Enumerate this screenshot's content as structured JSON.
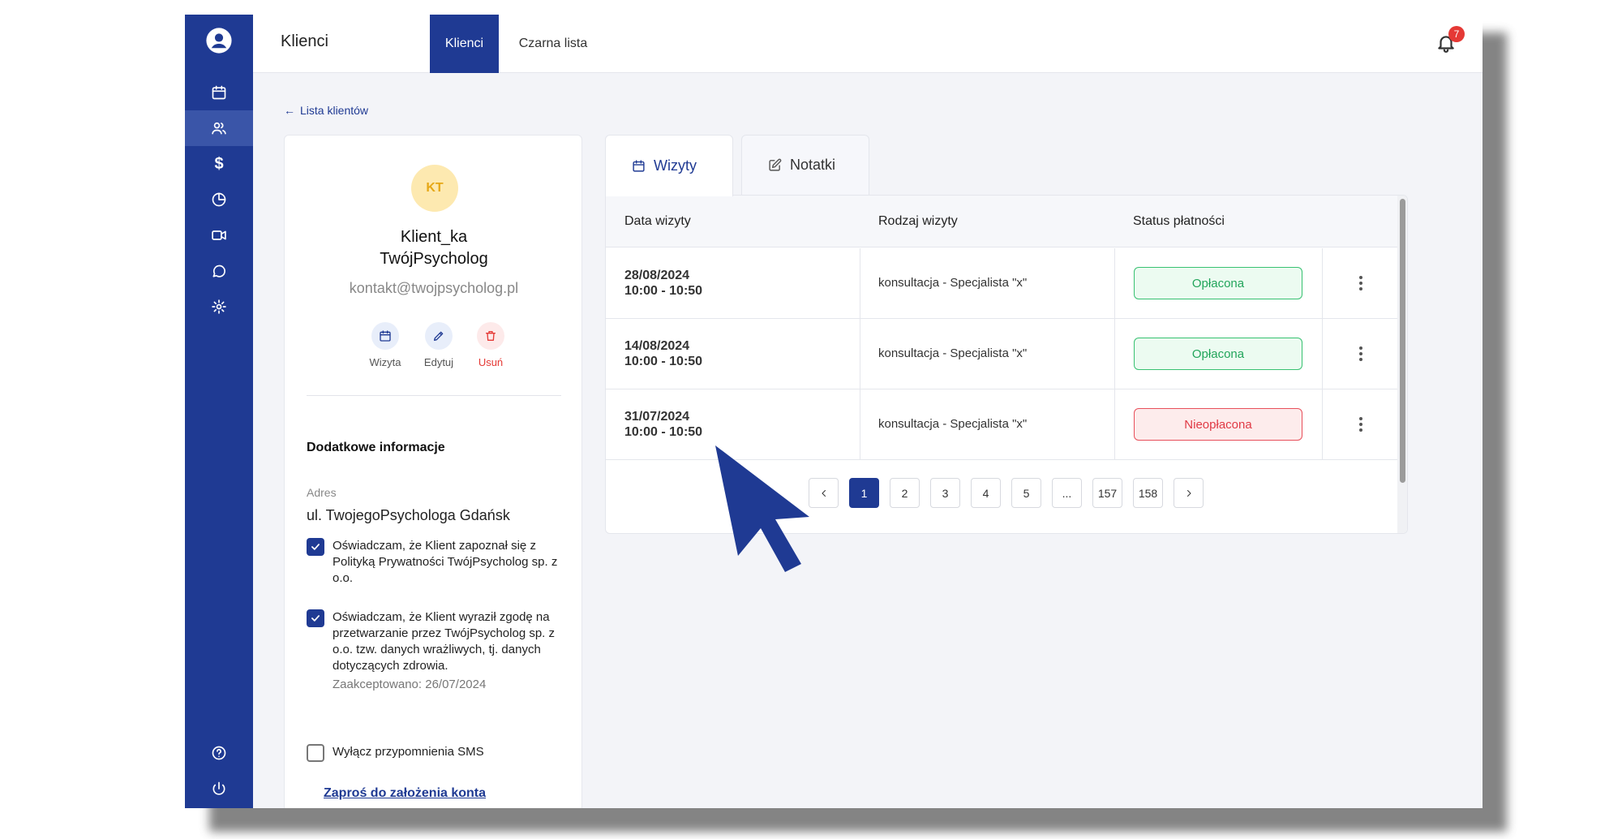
{
  "header": {
    "title": "Klienci",
    "tabs": [
      {
        "label": "Klienci",
        "active": true
      },
      {
        "label": "Czarna lista",
        "active": false
      }
    ],
    "notifications_count": "7"
  },
  "sidebar": {
    "items": [
      "user-circle-icon",
      "calendar-icon",
      "users-icon",
      "dollar-icon",
      "pie-chart-icon",
      "video-icon",
      "chat-icon",
      "gear-icon",
      "help-icon",
      "power-icon"
    ],
    "active_item": "users-icon",
    "dollar_glyph": "$"
  },
  "back_link": "Lista klientów",
  "client": {
    "initials": "KT",
    "name_line1": "Klient_ka",
    "name_line2": "TwójPsycholog",
    "email": "kontakt@twojpsycholog.pl",
    "actions": [
      "Wizyta",
      "Edytuj",
      "Usuń"
    ],
    "extra_heading": "Dodatkowe informacje",
    "address_label": "Adres",
    "address_value": "ul. TwojegoPsychologa Gdańsk",
    "checkboxes": [
      {
        "checked": true,
        "text": "Oświadczam, że Klient zapoznał się z Polityką Prywatności TwójPsycholog sp. z o.o.",
        "sub": ""
      },
      {
        "checked": true,
        "text": "Oświadczam, że Klient wyraził zgodę na przetwarzanie przez TwójPsycholog sp. z o.o. tzw. danych wrażliwych, tj. danych dotyczących zdrowia.",
        "sub": "Zaakceptowano: 26/07/2024"
      },
      {
        "checked": false,
        "text": "Wyłącz przypomnienia SMS",
        "sub": ""
      }
    ],
    "invite_link": "Zaproś do założenia konta"
  },
  "panel": {
    "tabs": [
      {
        "label": "Wizyty",
        "active": true
      },
      {
        "label": "Notatki",
        "active": false
      }
    ],
    "columns": [
      "Data wizyty",
      "Rodzaj wizyty",
      "Status płatności"
    ],
    "rows": [
      {
        "date": "28/08/2024",
        "time": "10:00 - 10:50",
        "type": "konsultacja - Specjalista \"x\"",
        "status": "Opłacona",
        "paid": true
      },
      {
        "date": "14/08/2024",
        "time": "10:00 - 10:50",
        "type": "konsultacja - Specjalista \"x\"",
        "status": "Opłacona",
        "paid": true
      },
      {
        "date": "31/07/2024",
        "time": "10:00 - 10:50",
        "type": "konsultacja - Specjalista \"x\"",
        "status": "Nieopłacona",
        "paid": false
      }
    ],
    "pagination": [
      "1",
      "2",
      "3",
      "4",
      "5",
      "...",
      "157",
      "158"
    ],
    "current_page": "1"
  },
  "colors": {
    "brand": "#1f3a93",
    "paid": "#22a55b",
    "unpaid": "#e03a45",
    "badge": "#e53935"
  }
}
